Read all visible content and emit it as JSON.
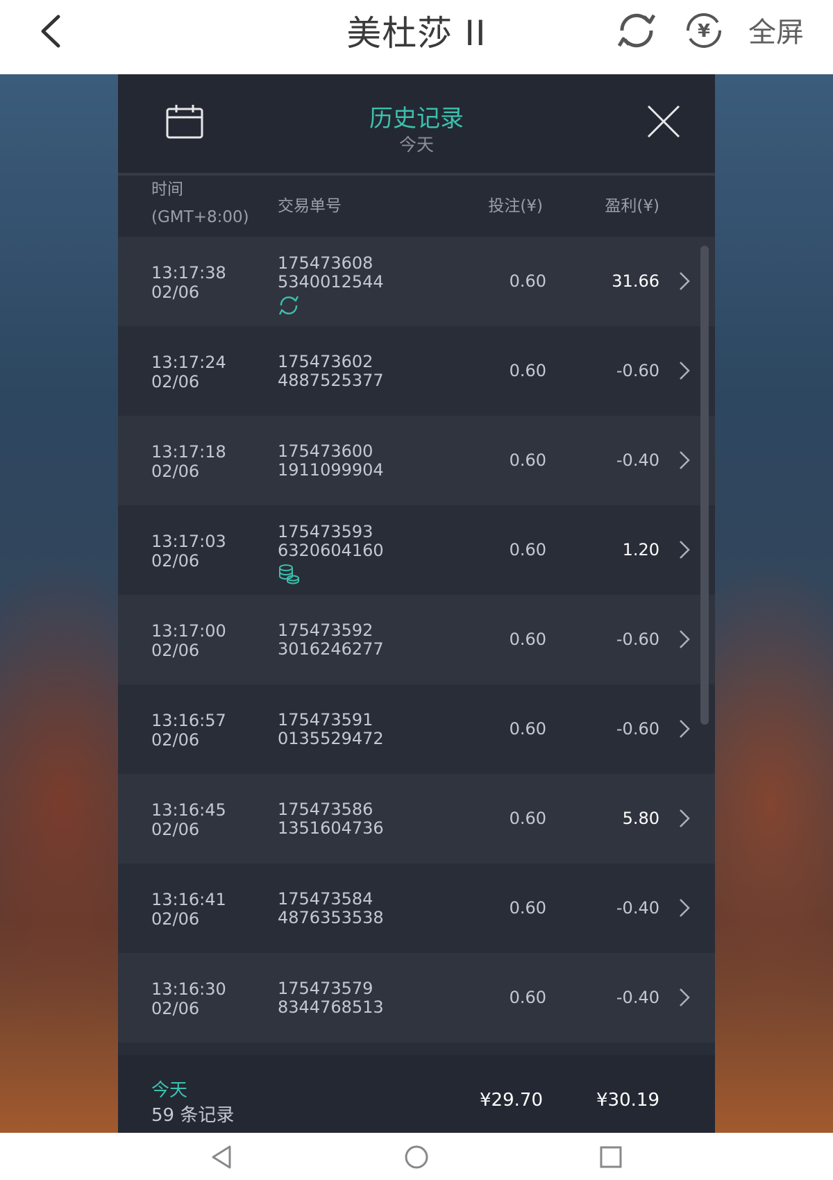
{
  "topbar": {
    "title": "美杜莎 II",
    "fullscreen_label": "全屏",
    "back_icon": "back-arrow-icon",
    "refresh_icon": "refresh-icon",
    "currency_icon": "yuan-switch-icon"
  },
  "panel": {
    "title": "历史记录",
    "subtitle": "今天",
    "calendar_icon": "calendar-icon",
    "close_icon": "close-icon",
    "columns": {
      "time_line1": "时间",
      "time_line2": "(GMT+8:00)",
      "order": "交易单号",
      "bet": "投注(¥)",
      "profit": "盈利(¥)"
    },
    "rows": [
      {
        "time": "13:17:38",
        "date": "02/06",
        "order1": "175473608",
        "order2": "5340012544",
        "bet": "0.60",
        "profit": "31.66",
        "badge": "respin-icon"
      },
      {
        "time": "13:17:24",
        "date": "02/06",
        "order1": "175473602",
        "order2": "4887525377",
        "bet": "0.60",
        "profit": "-0.60"
      },
      {
        "time": "13:17:18",
        "date": "02/06",
        "order1": "175473600",
        "order2": "1911099904",
        "bet": "0.60",
        "profit": "-0.40"
      },
      {
        "time": "13:17:03",
        "date": "02/06",
        "order1": "175473593",
        "order2": "6320604160",
        "bet": "0.60",
        "profit": "1.20",
        "badge": "coins-icon"
      },
      {
        "time": "13:17:00",
        "date": "02/06",
        "order1": "175473592",
        "order2": "3016246277",
        "bet": "0.60",
        "profit": "-0.60"
      },
      {
        "time": "13:16:57",
        "date": "02/06",
        "order1": "175473591",
        "order2": "0135529472",
        "bet": "0.60",
        "profit": "-0.60"
      },
      {
        "time": "13:16:45",
        "date": "02/06",
        "order1": "175473586",
        "order2": "1351604736",
        "bet": "0.60",
        "profit": "5.80"
      },
      {
        "time": "13:16:41",
        "date": "02/06",
        "order1": "175473584",
        "order2": "4876353538",
        "bet": "0.60",
        "profit": "-0.40"
      },
      {
        "time": "13:16:30",
        "date": "02/06",
        "order1": "175473579",
        "order2": "8344768513",
        "bet": "0.60",
        "profit": "-0.40"
      }
    ],
    "footer": {
      "period": "今天",
      "count": "59 条记录",
      "total_bet": "¥29.70",
      "total_profit": "¥30.19"
    }
  },
  "colors": {
    "accent": "#3cc0ad",
    "panel_bg": "#272b36",
    "row_alt": "#30343f"
  },
  "navbar": {
    "back_icon": "nav-back-icon",
    "home_icon": "nav-home-icon",
    "recents_icon": "nav-recents-icon"
  }
}
